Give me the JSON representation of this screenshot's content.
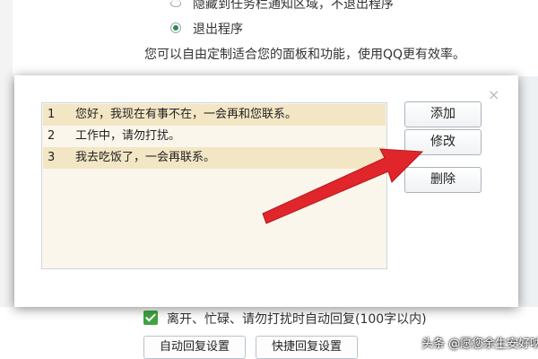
{
  "background": {
    "option_hide": "隐藏到任务栏通知区域，不退出程序",
    "option_exit": "退出程序",
    "panel_hint": "您可以自由定制适合您的面板和功能，使用QQ更有效率。",
    "auto_reply_checkbox": "离开、忙碌、请勿打扰时自动回复(100字以内)",
    "auto_reply_settings_button": "自动回复设置",
    "quick_reply_settings_button": "快捷回复设置"
  },
  "dialog": {
    "close_glyph": "×",
    "replies": [
      {
        "num": "1",
        "text": "您好，我现在有事不在，一会再和您联系。"
      },
      {
        "num": "2",
        "text": "工作中，请勿打扰。"
      },
      {
        "num": "3",
        "text": "我去吃饭了，一会再联系。"
      }
    ],
    "buttons": {
      "add": "添加",
      "edit": "修改",
      "delete": "删除"
    }
  },
  "watermark": "头条 @愿您余生安好呐",
  "colors": {
    "highlight_row": "#f2e6c4",
    "list_bg": "#fbf6ec",
    "arrow": "#e0262a",
    "checkbox": "#3ea542"
  }
}
